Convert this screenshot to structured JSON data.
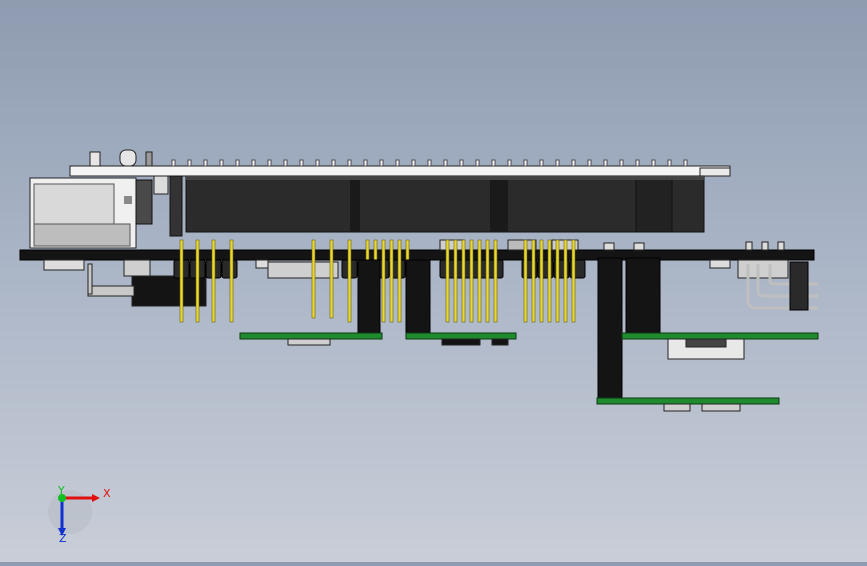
{
  "viewport": {
    "background_top": "#8e9bb0",
    "background_bottom": "#c9ced8"
  },
  "triad": {
    "x_label": "X",
    "y_label": "Y",
    "z_label": "Z",
    "x_color": "#e01010",
    "y_color": "#10c020",
    "z_color": "#1030d0"
  },
  "colors": {
    "pcb_green": "#1f8a2e",
    "pcb_black": "#141414",
    "header_body": "#2a2a2a",
    "pin_gold": "#e8d830",
    "connector_grey": "#c8c8c8"
  }
}
